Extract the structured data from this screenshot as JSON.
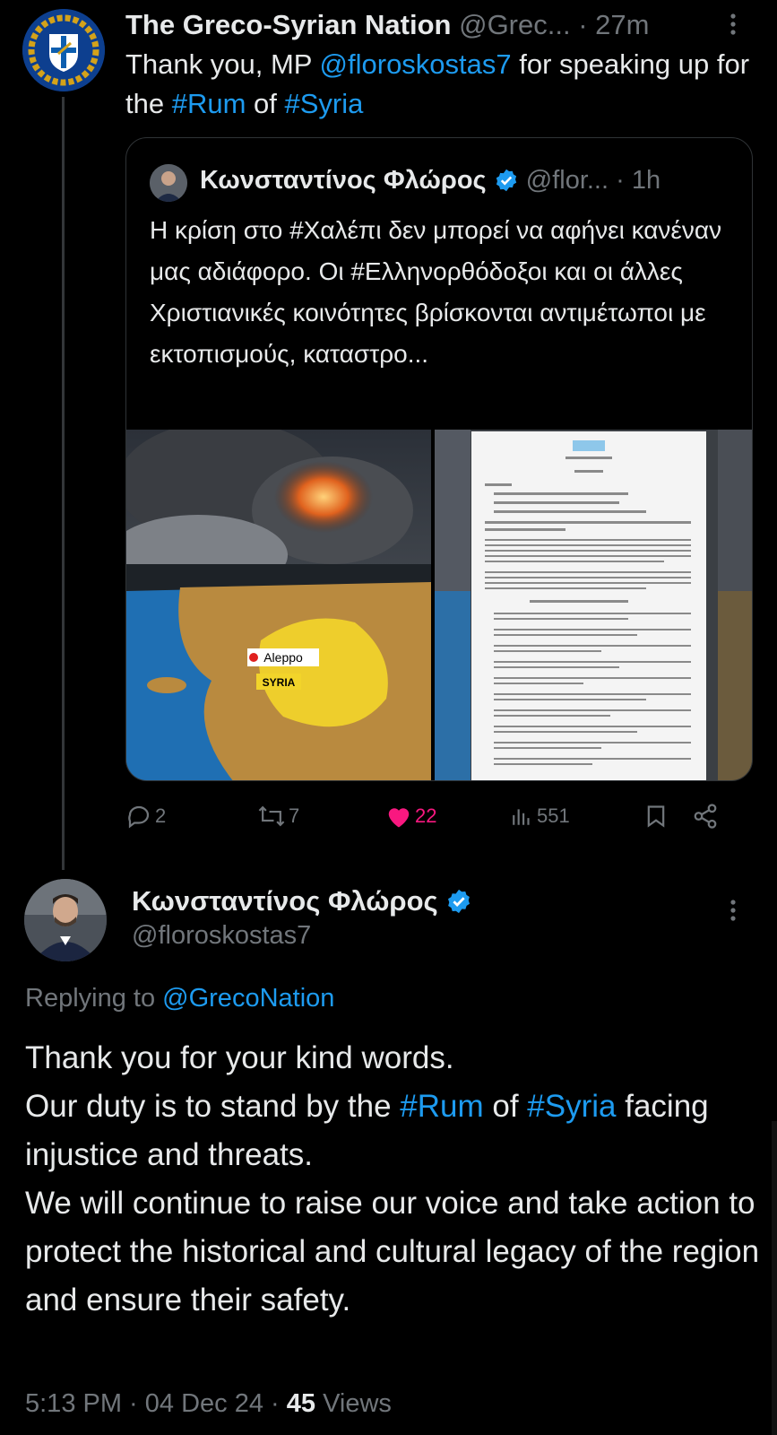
{
  "colors": {
    "background": "#000000",
    "text": "#e7e9ea",
    "muted": "#71767b",
    "link": "#1d9bf0",
    "like": "#f91880",
    "verified": "#1d9bf0"
  },
  "tweet1": {
    "author_name": "The Greco-Syrian Nation",
    "author_handle": "@Grec...",
    "time": "· 27m",
    "text_part1": "Thank you, MP ",
    "mention": "@floroskostas7",
    "text_part2": " for speaking up for the ",
    "hashtag1": "#Rum",
    "text_part3": " of ",
    "hashtag2": "#Syria",
    "more_icon": "more-vertical-icon"
  },
  "quote": {
    "author_name": "Κωνσταντίνος Φλώρος",
    "author_handle": "@flor...",
    "time": "· 1h",
    "text_part1": "Η κρίση στο ",
    "hashtag1": "#Χαλέπι",
    "text_part2": " δεν μπορεί να αφήνει κανέναν μας αδιάφορο. Οι ",
    "hashtag2": "#Ελληνορθόδοξοι",
    "text_part3": " και οι άλλες Χριστιανικές κοινότητες βρίσκονται αντιμέτωποι με εκτοπισμούς, καταστρο...",
    "map_label_city": "Aleppo",
    "map_label_country": "SYRIA"
  },
  "actions": {
    "replies": "2",
    "reposts": "7",
    "likes": "22",
    "views": "551"
  },
  "reply": {
    "author_name": "Κωνσταντίνος Φλώρος",
    "author_handle": "@floroskostas7",
    "replying_prefix": "Replying to ",
    "replying_handle": "@GrecoNation",
    "line1": "Thank you for your kind words.",
    "line2_part1": "Our duty is to stand by the ",
    "line2_hashtag1": "#Rum",
    "line2_part2": " of ",
    "line2_hashtag2": "#Syria",
    "line2_part3": " facing injustice and threats.",
    "line3": "We will continue to raise our voice and take action to protect the historical and cultural legacy of the region and ensure their safety.",
    "time": "5:13 PM · 04 Dec 24 · ",
    "views_count": "45",
    "views_label": " Views"
  }
}
